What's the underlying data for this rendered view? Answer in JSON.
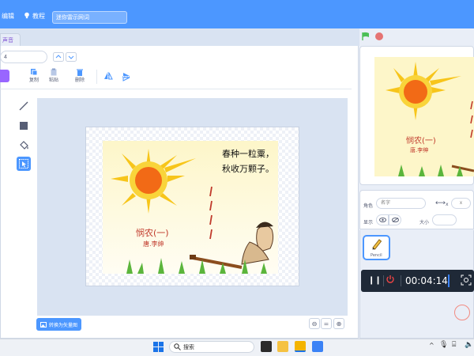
{
  "menu": {
    "edit_label": "编辑",
    "tutorials_label": "教程",
    "project_title": "迷你雷示网词"
  },
  "tabs": {
    "sounds_label": "声音"
  },
  "toolbar": {
    "costume_name": "4",
    "copy_label": "复制",
    "paste_label": "粘贴",
    "delete_label": "删除",
    "convert_label": "转换为矢量图"
  },
  "costume": {
    "poem_line1": "春种一粒粟，",
    "poem_line2": "秋收万颗子。",
    "title": "悯农(一)",
    "author": "唐.李绅"
  },
  "stage": {
    "title": "悯农(一)",
    "author": "唐.李绅"
  },
  "sprite_info": {
    "sprite_label": "角色",
    "sprite_name_placeholder": "名字",
    "x_label": "x",
    "show_label": "显示",
    "size_label": "大小"
  },
  "sprites": [
    {
      "name": "Pencil"
    }
  ],
  "recorder": {
    "timer": "00:04:14"
  },
  "taskbar": {
    "search_label": "搜索"
  },
  "colors": {
    "accent": "#4c97ff",
    "fill_color": "#9966ff",
    "poem_red": "#c0392b"
  }
}
